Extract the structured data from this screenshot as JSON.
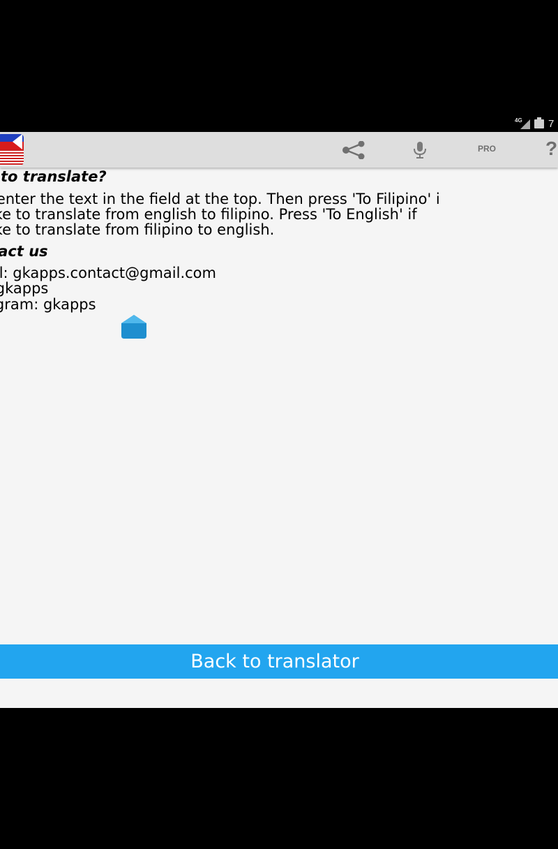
{
  "status_bar": {
    "network_label": "4G",
    "clock": "7"
  },
  "action_bar": {
    "pro_label": "PRO",
    "help_label": "?",
    "icons": [
      "flag-icon",
      "share-icon",
      "mic-icon",
      "help-icon"
    ]
  },
  "help": {
    "heading": "v to translate?",
    "lines": [
      "t enter the text in the field at the top. Then press 'To Filipino' i",
      " like to translate from english to filipino. Press 'To English' if",
      " like to translate from filipino to english."
    ]
  },
  "contact": {
    "heading": "itact us",
    "lines": [
      "ail: gkapps.contact@gmail.com",
      ": gkapps",
      "egram: gkapps"
    ]
  },
  "back_button_label": "Back to translator",
  "colors": {
    "accent": "#22a5ef",
    "action_bar": "#dedede",
    "background": "#f5f5f5"
  }
}
